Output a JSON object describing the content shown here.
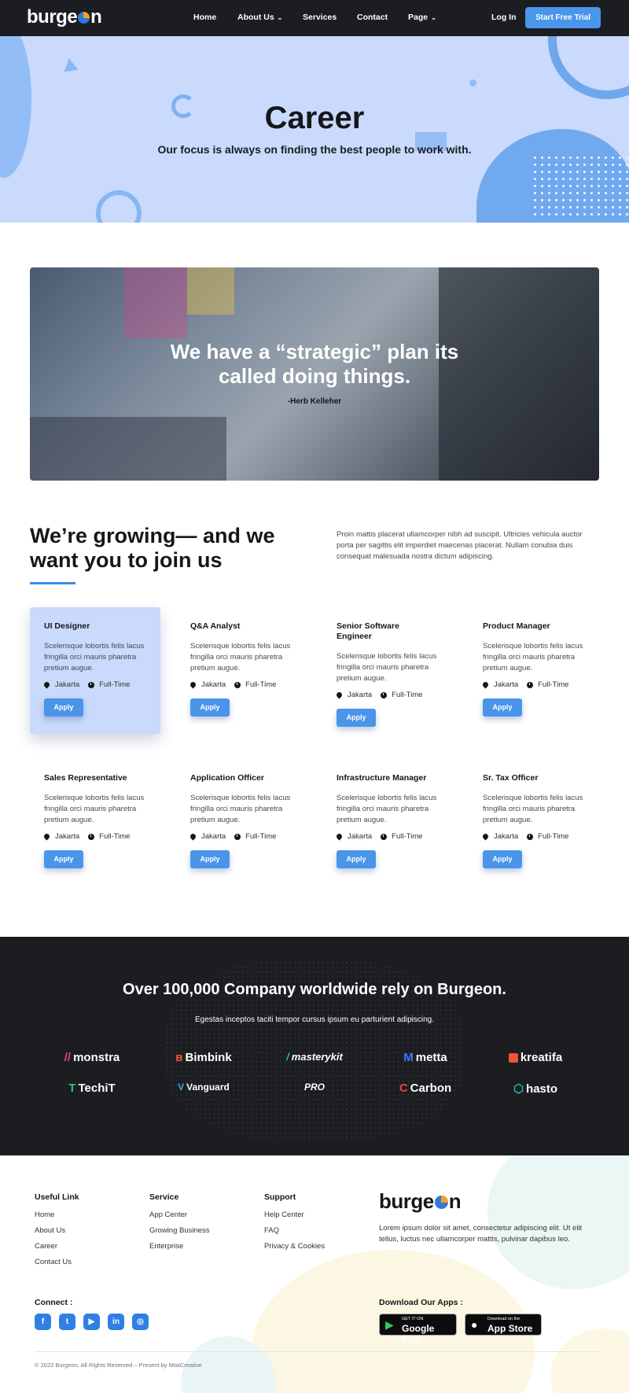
{
  "nav": {
    "logo": "burgeon",
    "links": [
      {
        "label": "Home",
        "has_dropdown": false
      },
      {
        "label": "About Us",
        "has_dropdown": true
      },
      {
        "label": "Services",
        "has_dropdown": false
      },
      {
        "label": "Contact",
        "has_dropdown": false
      },
      {
        "label": "Page",
        "has_dropdown": true
      }
    ],
    "login": "Log In",
    "cta": "Start Free Trial"
  },
  "hero": {
    "title": "Career",
    "subtitle": "Our focus is always on finding the best people to work with."
  },
  "quote": {
    "text": "We have a “strategic” plan its called doing things.",
    "author": "-Herb Kelleher"
  },
  "growing": {
    "heading": "We’re growing— and we want you to join us",
    "body": "Proin mattis placerat ullamcorper nibh ad suscipit. Ultricies vehicula auctor porta per sagittis elit imperdiet maecenas placerat. Nullam conubia duis consequat malesuada nostra dictum adipiscing."
  },
  "jobs": [
    {
      "title": "UI Designer",
      "desc": "Scelerisque lobortis felis lacus fringilla orci mauris pharetra pretium augue.",
      "location": "Jakarta",
      "type": "Full-Time",
      "apply": "Apply"
    },
    {
      "title": "Q&A Analyst",
      "desc": "Scelerisque lobortis felis lacus fringilla orci mauris pharetra pretium augue.",
      "location": "Jakarta",
      "type": "Full-Time",
      "apply": "Apply"
    },
    {
      "title": "Senior Software Engineer",
      "desc": "Scelerisque lobortis felis lacus fringilla orci mauris pharetra pretium augue.",
      "location": "Jakarta",
      "type": "Full-Time",
      "apply": "Apply"
    },
    {
      "title": "Product Manager",
      "desc": "Scelerisque lobortis felis lacus fringilla orci mauris pharetra pretium augue.",
      "location": "Jakarta",
      "type": "Full-Time",
      "apply": "Apply"
    },
    {
      "title": "Sales Representative",
      "desc": "Scelerisque lobortis felis lacus fringilla orci mauris pharetra pretium augue.",
      "location": "Jakarta",
      "type": "Full-Time",
      "apply": "Apply"
    },
    {
      "title": "Application Officer",
      "desc": "Scelerisque lobortis felis lacus fringilla orci mauris pharetra pretium augue.",
      "location": "Jakarta",
      "type": "Full-Time",
      "apply": "Apply"
    },
    {
      "title": "Infrastructure Manager",
      "desc": "Scelerisque lobortis felis lacus fringilla orci mauris pharetra pretium augue.",
      "location": "Jakarta",
      "type": "Full-Time",
      "apply": "Apply"
    },
    {
      "title": "Sr. Tax Officer",
      "desc": "Scelerisque lobortis felis lacus fringilla orci mauris pharetra pretium augue.",
      "location": "Jakarta",
      "type": "Full-Time",
      "apply": "Apply"
    }
  ],
  "companies": {
    "heading": "Over 100,000 Company worldwide rely on Burgeon.",
    "sub": "Egestas inceptos taciti tempor cursus ipsum eu parturient adipiscing.",
    "brands": [
      {
        "name": "monstra",
        "icon": "monstra-logo",
        "color": "#e23fa0"
      },
      {
        "name": "Bimbink",
        "icon": "bimbink-logo",
        "color": "#ef5a35"
      },
      {
        "name": "masterykit",
        "icon": "masterykit-logo",
        "color": "#2ec78a"
      },
      {
        "name": "metta",
        "icon": "metta-logo",
        "color": "#3a7bff"
      },
      {
        "name": "kreatifa",
        "icon": "kreatifa-logo",
        "color": "#f0523a"
      },
      {
        "name": "TechiT",
        "icon": "techit-logo",
        "color": "#36c070"
      },
      {
        "name": "Vanguard",
        "icon": "vanguard-logo",
        "color": "#3aa8e6"
      },
      {
        "name": "PRO",
        "icon": "pro-logo",
        "color": "#ffffff"
      },
      {
        "name": "Carbon",
        "icon": "carbon-logo",
        "color": "#ef3e4a"
      },
      {
        "name": "hasto",
        "icon": "hasto-logo",
        "color": "#2ab5b0"
      }
    ]
  },
  "footer": {
    "columns": [
      {
        "title": "Useful Link",
        "links": [
          "Home",
          "About Us",
          "Career",
          "Contact Us"
        ]
      },
      {
        "title": "Service",
        "links": [
          "App Center",
          "Growing Business",
          "Enterprise"
        ]
      },
      {
        "title": "Support",
        "links": [
          "Help Center",
          "FAQ",
          "Privacy & Cookies"
        ]
      }
    ],
    "logo": "burgeon",
    "about": "Lorem ipsum dolor sit amet, consectetur adipiscing elit. Ut elit tellus, luctus nec ullamcorper mattis, pulvinar dapibus leo.",
    "connect": "Connect :",
    "socials": [
      "facebook-icon",
      "twitter-icon",
      "youtube-icon",
      "linkedin-icon",
      "instagram-icon"
    ],
    "download": "Download Our Apps :",
    "google_play": {
      "small": "GET IT ON",
      "big": "Google Play"
    },
    "app_store": {
      "small": "Download on the",
      "big": "App Store"
    },
    "copyright": "© 2022 Burgeon, All Rights Reserved – Present by MoxCreative"
  },
  "colors": {
    "accent": "#4a95ea",
    "dark": "#1b1d21",
    "hero_bg": "#c9dafc"
  }
}
